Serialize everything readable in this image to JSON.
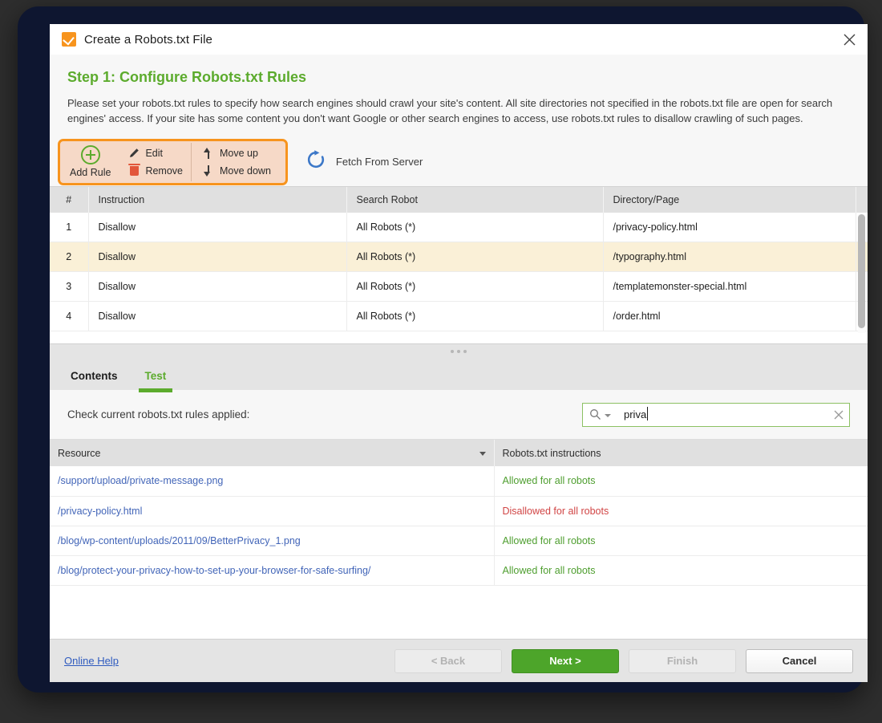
{
  "window": {
    "title": "Create a Robots.txt File",
    "title_icon": "checkbox-checked-icon",
    "close_icon": "close-icon"
  },
  "header": {
    "step_title": "Step 1: Configure Robots.txt Rules",
    "description": "Please set your robots.txt rules to specify how search engines should crawl your site's content. All site directories not specified in the robots.txt file are open for search engines' access. If your site has some content you don't want Google or other search engines to access, use robots.txt rules to disallow crawling of such pages."
  },
  "toolbar": {
    "add_rule": "Add Rule",
    "edit": "Edit",
    "remove": "Remove",
    "move_up": "Move up",
    "move_down": "Move down",
    "fetch_from_server": "Fetch From Server",
    "highlight_color": "#f7941e",
    "highlight_fill": "#f6d9c7"
  },
  "rules_table": {
    "headers": [
      "#",
      "Instruction",
      "Search Robot",
      "Directory/Page"
    ],
    "rows": [
      {
        "num": "1",
        "instruction": "Disallow",
        "robot": "All Robots (*)",
        "directory": "/privacy-policy.html",
        "selected": false
      },
      {
        "num": "2",
        "instruction": "Disallow",
        "robot": "All Robots (*)",
        "directory": "/typography.html",
        "selected": true
      },
      {
        "num": "3",
        "instruction": "Disallow",
        "robot": "All Robots (*)",
        "directory": "/templatemonster-special.html",
        "selected": false
      },
      {
        "num": "4",
        "instruction": "Disallow",
        "robot": "All Robots (*)",
        "directory": "/order.html",
        "selected": false
      }
    ],
    "selected_row_color": "#faf0d7"
  },
  "tabs": [
    {
      "label": "Contents",
      "active": false
    },
    {
      "label": "Test",
      "active": true
    }
  ],
  "test_panel": {
    "check_label": "Check current robots.txt rules applied:",
    "search_value": "priva",
    "search_icon": "search-icon",
    "dropdown_icon": "chevron-down-icon",
    "clear_icon": "clear-icon",
    "border_color": "#8cc163"
  },
  "results_table": {
    "headers": [
      "Resource",
      "Robots.txt instructions"
    ],
    "rows": [
      {
        "resource": "/support/upload/private-message.png",
        "instruction": "Allowed for all robots",
        "status": "allowed"
      },
      {
        "resource": "/privacy-policy.html",
        "instruction": "Disallowed for all robots",
        "status": "disallowed"
      },
      {
        "resource": "/blog/wp-content/uploads/2011/09/BetterPrivacy_1.png",
        "instruction": "Allowed for all robots",
        "status": "allowed"
      },
      {
        "resource": "/blog/protect-your-privacy-how-to-set-up-your-browser-for-safe-surfing/",
        "instruction": "Allowed for all robots",
        "status": "allowed"
      }
    ],
    "allowed_color": "#4e9e2f",
    "disallowed_color": "#d14545",
    "link_color": "#4265b8"
  },
  "footer": {
    "online_help": "Online Help",
    "back": "< Back",
    "next": "Next >",
    "finish": "Finish",
    "cancel": "Cancel",
    "primary_color": "#4da52a"
  }
}
